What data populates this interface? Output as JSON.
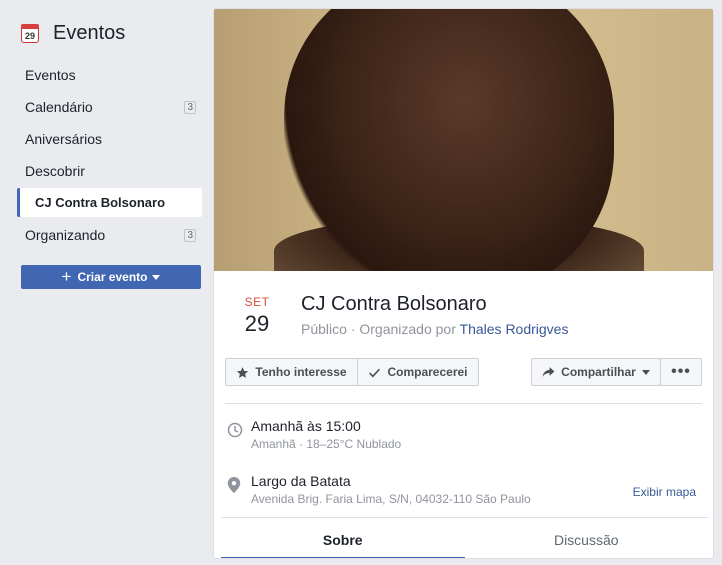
{
  "sidebar": {
    "icon_day": "29",
    "title": "Eventos",
    "items": [
      {
        "label": "Eventos",
        "badge": ""
      },
      {
        "label": "Calendário",
        "badge": "3"
      },
      {
        "label": "Aniversários",
        "badge": ""
      },
      {
        "label": "Descobrir",
        "badge": ""
      },
      {
        "label": "CJ Contra Bolsonaro",
        "badge": "",
        "active": true
      },
      {
        "label": "Organizando",
        "badge": "3"
      }
    ],
    "create_label": "Criar evento"
  },
  "event": {
    "month": "SET",
    "day": "29",
    "title": "CJ Contra Bolsonaro",
    "privacy": "Público",
    "organized_by_prefix": "Organizado por",
    "organizer": "Thales Rodrigves",
    "separator": "·"
  },
  "actions": {
    "interest": "Tenho interesse",
    "going": "Comparecerei",
    "share": "Compartilhar",
    "more": "•••"
  },
  "time": {
    "main": "Amanhã às 15:00",
    "sub": "Amanhã · 18–25°C Nublado"
  },
  "location": {
    "main": "Largo da Batata",
    "sub": "Avenida Brig. Faria Lima, S/N, 04032-110 São Paulo",
    "map_link": "Exibir mapa"
  },
  "tabs": [
    {
      "label": "Sobre",
      "active": true
    },
    {
      "label": "Discussão",
      "active": false
    }
  ],
  "colors": {
    "accent": "#4267b2",
    "link": "#385898",
    "month_red": "#e04a3e",
    "background": "#e9ebee"
  }
}
